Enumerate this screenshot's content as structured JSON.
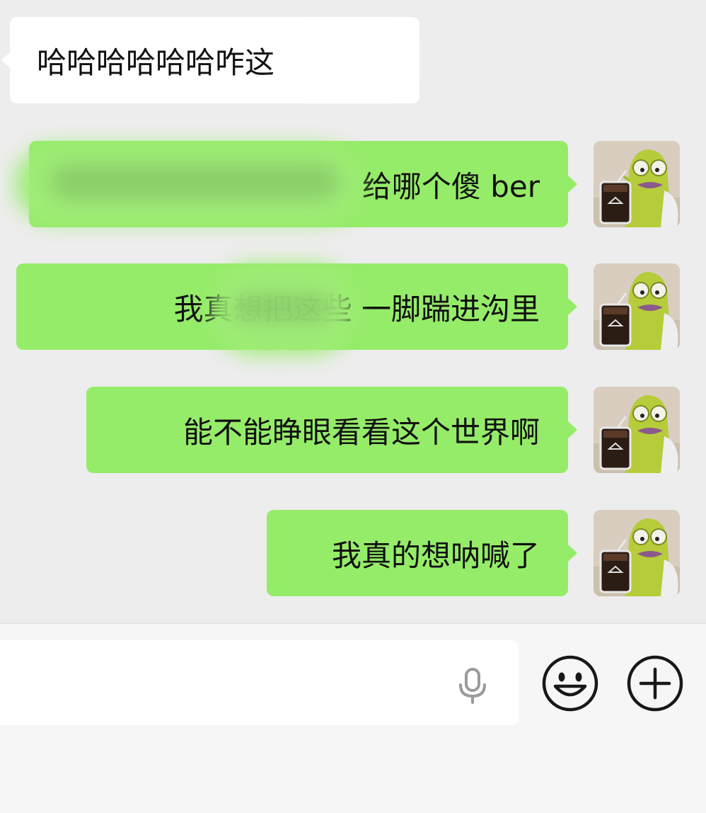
{
  "messages": [
    {
      "direction": "in",
      "text": "哈哈哈哈哈哈咋这"
    },
    {
      "direction": "out",
      "text": "给哪个傻 ber"
    },
    {
      "direction": "out",
      "text": "我真想把这些  一脚踹进沟里"
    },
    {
      "direction": "out",
      "text": "能不能睁眼看看这个世界啊"
    },
    {
      "direction": "out",
      "text": "我真的想呐喊了"
    }
  ],
  "input": {
    "value": "",
    "placeholder": ""
  },
  "icons": {
    "voice": "microphone-icon",
    "emoji": "smiley-face-icon",
    "more": "plus-circle-icon"
  },
  "colors": {
    "background": "#ededed",
    "incoming_bubble": "#ffffff",
    "outgoing_bubble": "#95ec69",
    "input_bar": "#f6f6f6",
    "icon_stroke": "#181818"
  }
}
